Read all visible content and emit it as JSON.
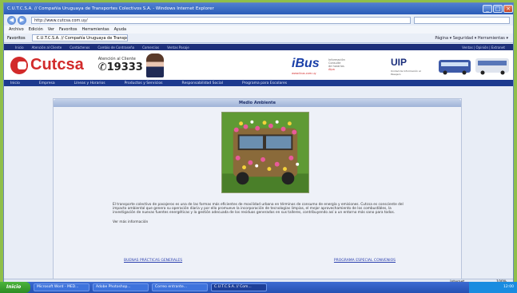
{
  "window": {
    "title": "C.U.T.C.S.A. // Compañía Uruguaya de Transportes Colectivos S.A. - Windows Internet Explorer",
    "url": "http://www.cutcsa.com.uy/",
    "menu": [
      "Archivo",
      "Edición",
      "Ver",
      "Favoritos",
      "Herramientas",
      "Ayuda"
    ],
    "favorites_label": "Favoritos",
    "tab_label": "C.U.T.C.S.A. // Compañía Uruguaya de Transportes...",
    "tools": "Página ▾   Seguridad ▾   Herramientas ▾"
  },
  "site": {
    "top_links": [
      "Inicio",
      "Atención al Cliente",
      "Contáctenos",
      "Cambio de Contraseña",
      "Comercios",
      "Ventas Pasaje"
    ],
    "top_right": "Ventas | Opinión | Extranet",
    "brand": "Cutcsa",
    "contact_label": "Atención al Cliente",
    "phone": "19333",
    "ibus": "iBus",
    "ibus_sub": "www.ibus.com.uy",
    "ibus_text": [
      "Información",
      "Consulte",
      "de horarios",
      "Alpa"
    ],
    "uip": "UIP",
    "uip_sub": "Unidad de Información al Pasajero",
    "nav": [
      "Inicio",
      "Empresa",
      "Líneas y Horarios",
      "Productos y Servicios",
      "Responsabilidad Social",
      "Programa para Escolares"
    ]
  },
  "content": {
    "section_title": "Medio Ambiente",
    "paragraph": "El transporte colectivo de pasajeros es una de las formas más eficientes de movilidad urbana en términos de consumo de energía y emisiones. Cutcsa es consciente del impacto ambiental que genera su operación diaria y por ello promueve la incorporación de tecnologías limpias, el mejor aprovechamiento de los combustibles, la investigación de nuevas fuentes energéticas y la gestión adecuada de los residuos generados en sus talleres, contribuyendo así a un entorno más sano para todos.",
    "more_info": "Ver más información",
    "link_left": "BUENAS PRÁCTICAS GENERALES",
    "link_right": "PROGRAMA ESPECIAL CONVENIOS"
  },
  "status": {
    "zone": "Internet",
    "zoom": "100%"
  },
  "taskbar": {
    "start": "Inicio",
    "tasks": [
      "Microsoft Word - MED...",
      "Adobe Photoshop...",
      "Correo entrante...",
      "C.U.T.C.S.A. // Com..."
    ],
    "clock": "12:00"
  }
}
